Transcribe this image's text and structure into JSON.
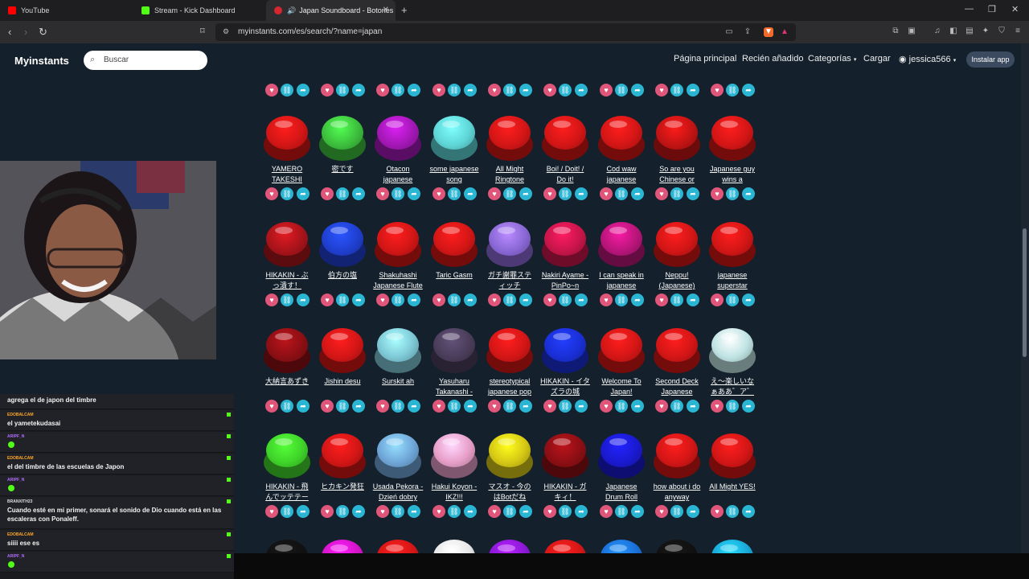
{
  "browser": {
    "tabs": [
      {
        "label": "YouTube",
        "color": "#ff0000"
      },
      {
        "label": "Stream - Kick Dashboard",
        "color": "#53fc18"
      },
      {
        "label": "Japan Soundboard - Botones",
        "color": "#d6262f"
      }
    ],
    "url": "myinstants.com/es/search/?name=japan"
  },
  "site": {
    "logo": "Myinstants",
    "search_placeholder": "Buscar",
    "nav": [
      "Página principal",
      "Recién añadido",
      "Categorías",
      "Cargar"
    ],
    "user": "jessica566",
    "install": "Instalar app"
  },
  "rows": [
    {
      "buttons": [
        {
          "l1": "YAMERO",
          "l2": "TAKESHI",
          "color": "#d41616"
        },
        {
          "l1": "密です",
          "l2": "",
          "color": "#3dbf3d"
        },
        {
          "l1": "Otacon",
          "l2": "japanese",
          "color": "#a318b5"
        },
        {
          "l1": "some japanese",
          "l2": "song",
          "color": "#5fd6d8"
        },
        {
          "l1": "All Might",
          "l2": "Ringtone",
          "color": "#d41616"
        },
        {
          "l1": "Boi! / Doit! /",
          "l2": "Do it!",
          "color": "#d41616"
        },
        {
          "l1": "Cod waw",
          "l2": "japanese",
          "color": "#d41616"
        },
        {
          "l1": "So are you",
          "l2": "Chinese or",
          "color": "#c21414"
        },
        {
          "l1": "Japanese guy",
          "l2": "wins a",
          "color": "#d41616"
        }
      ]
    },
    {
      "buttons": [
        {
          "l1": "HIKAKIN - ぶ",
          "l2": "っ潰す！",
          "color": "#a8141a"
        },
        {
          "l1": "伯方の塩",
          "l2": "",
          "color": "#1f3fd0"
        },
        {
          "l1": "Shakuhashi",
          "l2": "Japanese Flute",
          "color": "#d41616"
        },
        {
          "l1": "Taric Gasm",
          "l2": "",
          "color": "#d41616"
        },
        {
          "l1": "ガチ謝罪ステ",
          "l2": "ィッチ",
          "color": "#8a68d6"
        },
        {
          "l1": "Nakiri Ayame -",
          "l2": "PinPo~n",
          "color": "#c8154a"
        },
        {
          "l1": "I can speak in",
          "l2": "japanese",
          "color": "#b8157a"
        },
        {
          "l1": "Neppu!",
          "l2": "(Japanese)",
          "color": "#d41616"
        },
        {
          "l1": "japanese",
          "l2": "superstar",
          "color": "#d41616"
        }
      ]
    },
    {
      "buttons": [
        {
          "l1": "大納言あずき",
          "l2": "",
          "color": "#8c0f14"
        },
        {
          "l1": "Jishin desu",
          "l2": "",
          "color": "#d41616"
        },
        {
          "l1": "Surskit ah",
          "l2": "",
          "color": "#7ec8d6"
        },
        {
          "l1": "Yasuharu",
          "l2": "Takanashi -",
          "color": "#4a3d5a"
        },
        {
          "l1": "stereotypical",
          "l2": "japanese pop",
          "color": "#d41616"
        },
        {
          "l1": "HIKAKIN - イタ",
          "l2": "ズラの城",
          "color": "#1a2fd6"
        },
        {
          "l1": "Welcome To",
          "l2": "Japan!",
          "color": "#d41616"
        },
        {
          "l1": "Second Deck",
          "l2": "Japanese",
          "color": "#d41616"
        },
        {
          "l1": "え〜楽しいな",
          "l2": "ぁああ゛ア゛",
          "color": "#bfe3e3"
        }
      ]
    },
    {
      "buttons": [
        {
          "l1": "HIKAKIN - 飛",
          "l2": "んでッテテー",
          "color": "#3fd42a"
        },
        {
          "l1": "ヒカキン発狂",
          "l2": "",
          "color": "#d41616"
        },
        {
          "l1": "Usada Pekora -",
          "l2": "Dzień dobry",
          "color": "#6fa6d8"
        },
        {
          "l1": "Hakui Koyon -",
          "l2": "IKZ!!!",
          "color": "#e79fc8"
        },
        {
          "l1": "マスオ - 今の",
          "l2": "はBotだね",
          "color": "#d6c815"
        },
        {
          "l1": "HIKAKIN - ガ",
          "l2": "キィ！",
          "color": "#8c0f14"
        },
        {
          "l1": "Japanese",
          "l2": "Drum Roll",
          "color": "#1a1ad0"
        },
        {
          "l1": "how about i do",
          "l2": "anyway",
          "color": "#d41616"
        },
        {
          "l1": "All Might YES!",
          "l2": "",
          "color": "#d41616"
        }
      ]
    },
    {
      "buttons": [
        {
          "l1": "",
          "l2": "",
          "color": "#111111"
        },
        {
          "l1": "",
          "l2": "",
          "color": "#d415c8"
        },
        {
          "l1": "",
          "l2": "",
          "color": "#d41616"
        },
        {
          "l1": "",
          "l2": "",
          "color": "#e8e8e8"
        },
        {
          "l1": "",
          "l2": "",
          "color": "#8a18d6"
        },
        {
          "l1": "",
          "l2": "",
          "color": "#d41616"
        },
        {
          "l1": "",
          "l2": "",
          "color": "#1a6fd6"
        },
        {
          "l1": "",
          "l2": "",
          "color": "#111111"
        },
        {
          "l1": "",
          "l2": "",
          "color": "#1aa6d6"
        }
      ]
    }
  ],
  "chat": [
    {
      "user": "",
      "msg": "agrega el de japon del timbre",
      "ucolor": "#ffa726"
    },
    {
      "user": "EDOBALCAM",
      "msg": "el yametekudasai",
      "ucolor": "#ffa726"
    },
    {
      "user": "ARIPF_N",
      "msg": "",
      "ucolor": "#b36bff",
      "emote": true
    },
    {
      "user": "EDOBALCAM",
      "msg": "el del timbre de las escuelas de Japon",
      "ucolor": "#ffa726"
    },
    {
      "user": "ARIPF_N",
      "msg": "",
      "ucolor": "#b36bff",
      "emote": true
    },
    {
      "user": "BRANXITH23",
      "msg": "Cuando esté en mi primer, sonará el sonido de Dio cuando está en las escaleras con Ponaleff.",
      "ucolor": "#dddddd"
    },
    {
      "user": "EDOBALCAM",
      "msg": "siiii ese es",
      "ucolor": "#ffa726"
    },
    {
      "user": "ARIPF_N",
      "msg": "",
      "ucolor": "#b36bff",
      "emote": true
    }
  ]
}
